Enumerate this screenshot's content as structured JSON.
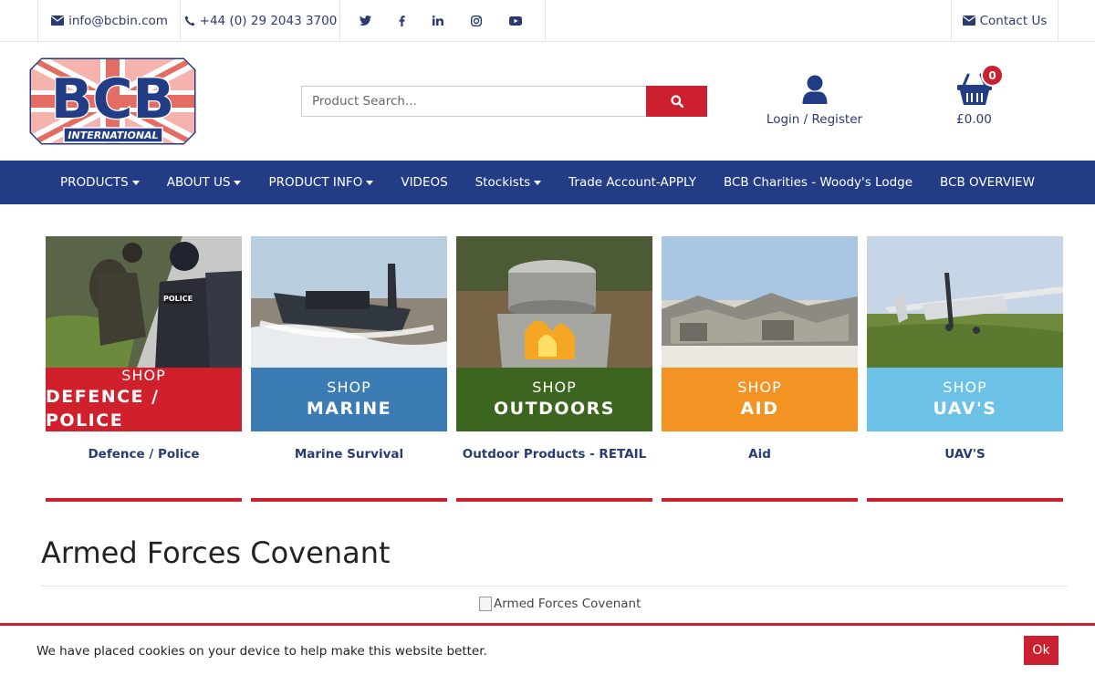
{
  "topbar": {
    "email": "info@bcbin.com",
    "phone": "+44 (0) 29 2043 3700",
    "social": [
      "twitter-icon",
      "facebook-icon",
      "linkedin-icon",
      "instagram-icon",
      "youtube-icon"
    ],
    "contact": "Contact Us"
  },
  "logo": {
    "text": "BCB",
    "subtext": "INTERNATIONAL"
  },
  "search": {
    "placeholder": "Product Search..."
  },
  "account": {
    "login": "Login",
    "separator": "/",
    "register": "Register"
  },
  "cart": {
    "count": "0",
    "total": "£0.00"
  },
  "nav": {
    "items": [
      {
        "label": "PRODUCTS",
        "dropdown": true
      },
      {
        "label": "ABOUT US",
        "dropdown": true
      },
      {
        "label": "PRODUCT INFO",
        "dropdown": true
      },
      {
        "label": "VIDEOS",
        "dropdown": false
      },
      {
        "label": "Stockists",
        "dropdown": true
      },
      {
        "label": "Trade Account-APPLY",
        "dropdown": false
      },
      {
        "label": "BCB Charities - Woody's Lodge",
        "dropdown": false
      },
      {
        "label": "BCB OVERVIEW",
        "dropdown": false
      }
    ]
  },
  "tiles": [
    {
      "shop": "SHOP",
      "name": "DEFENCE / POLICE",
      "caption": "Defence / Police",
      "color": "#d0202c"
    },
    {
      "shop": "SHOP",
      "name": "MARINE",
      "caption": "Marine Survival",
      "color": "#3b7cb4"
    },
    {
      "shop": "SHOP",
      "name": "OUTDOORS",
      "caption": "Outdoor Products - RETAIL",
      "color": "#3c661f"
    },
    {
      "shop": "SHOP",
      "name": "AID",
      "caption": "Aid",
      "color": "#f39323"
    },
    {
      "shop": "SHOP",
      "name": "UAV'S",
      "caption": "UAV'S",
      "color": "#6cc1e6"
    }
  ],
  "section": {
    "title": "Armed Forces Covenant",
    "image_alt": "Armed Forces Covenant"
  },
  "cookie": {
    "message": "We have placed cookies on your device to help make this website better.",
    "button": "Ok"
  },
  "colors": {
    "navy": "#223c86",
    "red": "#cc1f2f",
    "text_link": "#2b3b70"
  }
}
